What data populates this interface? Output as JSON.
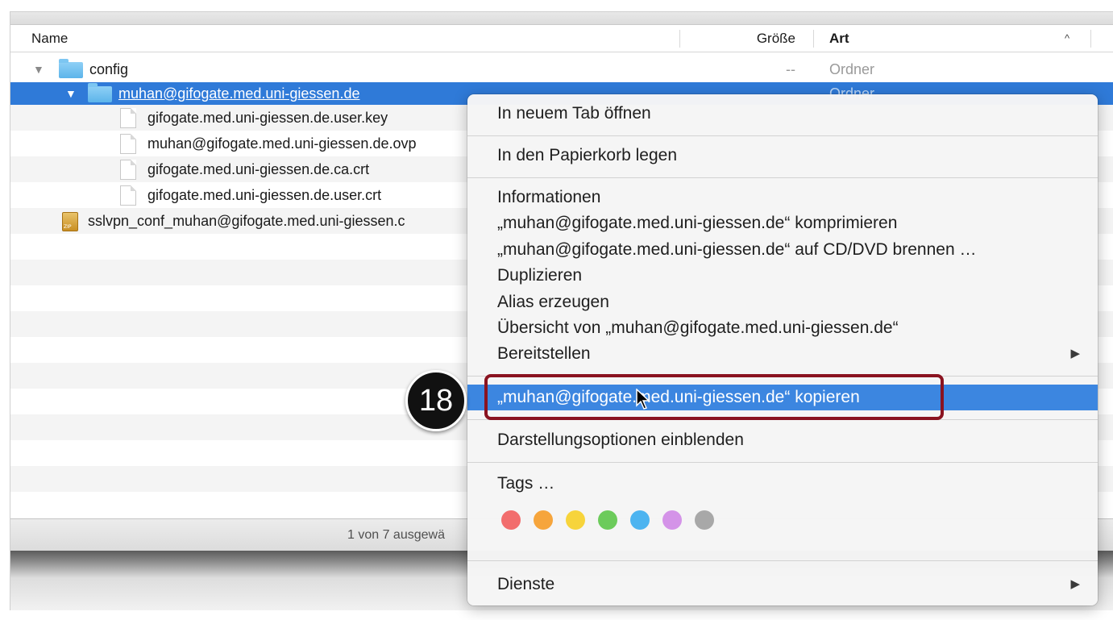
{
  "columns": {
    "name": "Name",
    "size": "Größe",
    "kind": "Art",
    "sort_indicator": "^"
  },
  "rows": [
    {
      "name": "config",
      "size": "--",
      "kind": "Ordner",
      "icon": "folder-icon",
      "expanded": true
    },
    {
      "name": "muhan@gifogate.med.uni-giessen.de",
      "size": "",
      "kind": "Ordner",
      "icon": "folder-icon",
      "expanded": true,
      "selected": true
    },
    {
      "name": "gifogate.med.uni-giessen.de.user.key",
      "icon": "document-icon"
    },
    {
      "name": "muhan@gifogate.med.uni-giessen.de.ovp",
      "icon": "document-icon"
    },
    {
      "name": "gifogate.med.uni-giessen.de.ca.crt",
      "icon": "document-icon"
    },
    {
      "name": "gifogate.med.uni-giessen.de.user.crt",
      "icon": "document-icon"
    },
    {
      "name": "sslvpn_conf_muhan@gifogate.med.uni-giessen.c",
      "icon": "zip-archive-icon"
    }
  ],
  "status_bar": {
    "text": "1 von 7 ausgewä"
  },
  "context_menu": {
    "open_in_new_tab": "In neuem Tab öffnen",
    "move_to_trash": "In den Papierkorb legen",
    "get_info": "Informationen",
    "compress": "„muhan@gifogate.med.uni-giessen.de“ komprimieren",
    "burn": "„muhan@gifogate.med.uni-giessen.de“ auf CD/DVD brennen …",
    "duplicate": "Duplizieren",
    "make_alias": "Alias erzeugen",
    "quick_look": "Übersicht von „muhan@gifogate.med.uni-giessen.de“",
    "share": "Bereitstellen",
    "copy": "„muhan@gifogate.med.uni-giessen.de“ kopieren",
    "show_view_options": "Darstellungsoptionen einblenden",
    "tags": "Tags …",
    "services": "Dienste",
    "tag_colors": [
      "#f26d6d",
      "#f6a53c",
      "#f7d43b",
      "#6ccb5b",
      "#4db4f0",
      "#d493e8",
      "#a8a8a8"
    ]
  },
  "annotation": {
    "step_number": "18"
  },
  "colors": {
    "selection": "#2f7ad8",
    "menu_highlight": "#3c86e0",
    "callout": "#8a1320"
  }
}
